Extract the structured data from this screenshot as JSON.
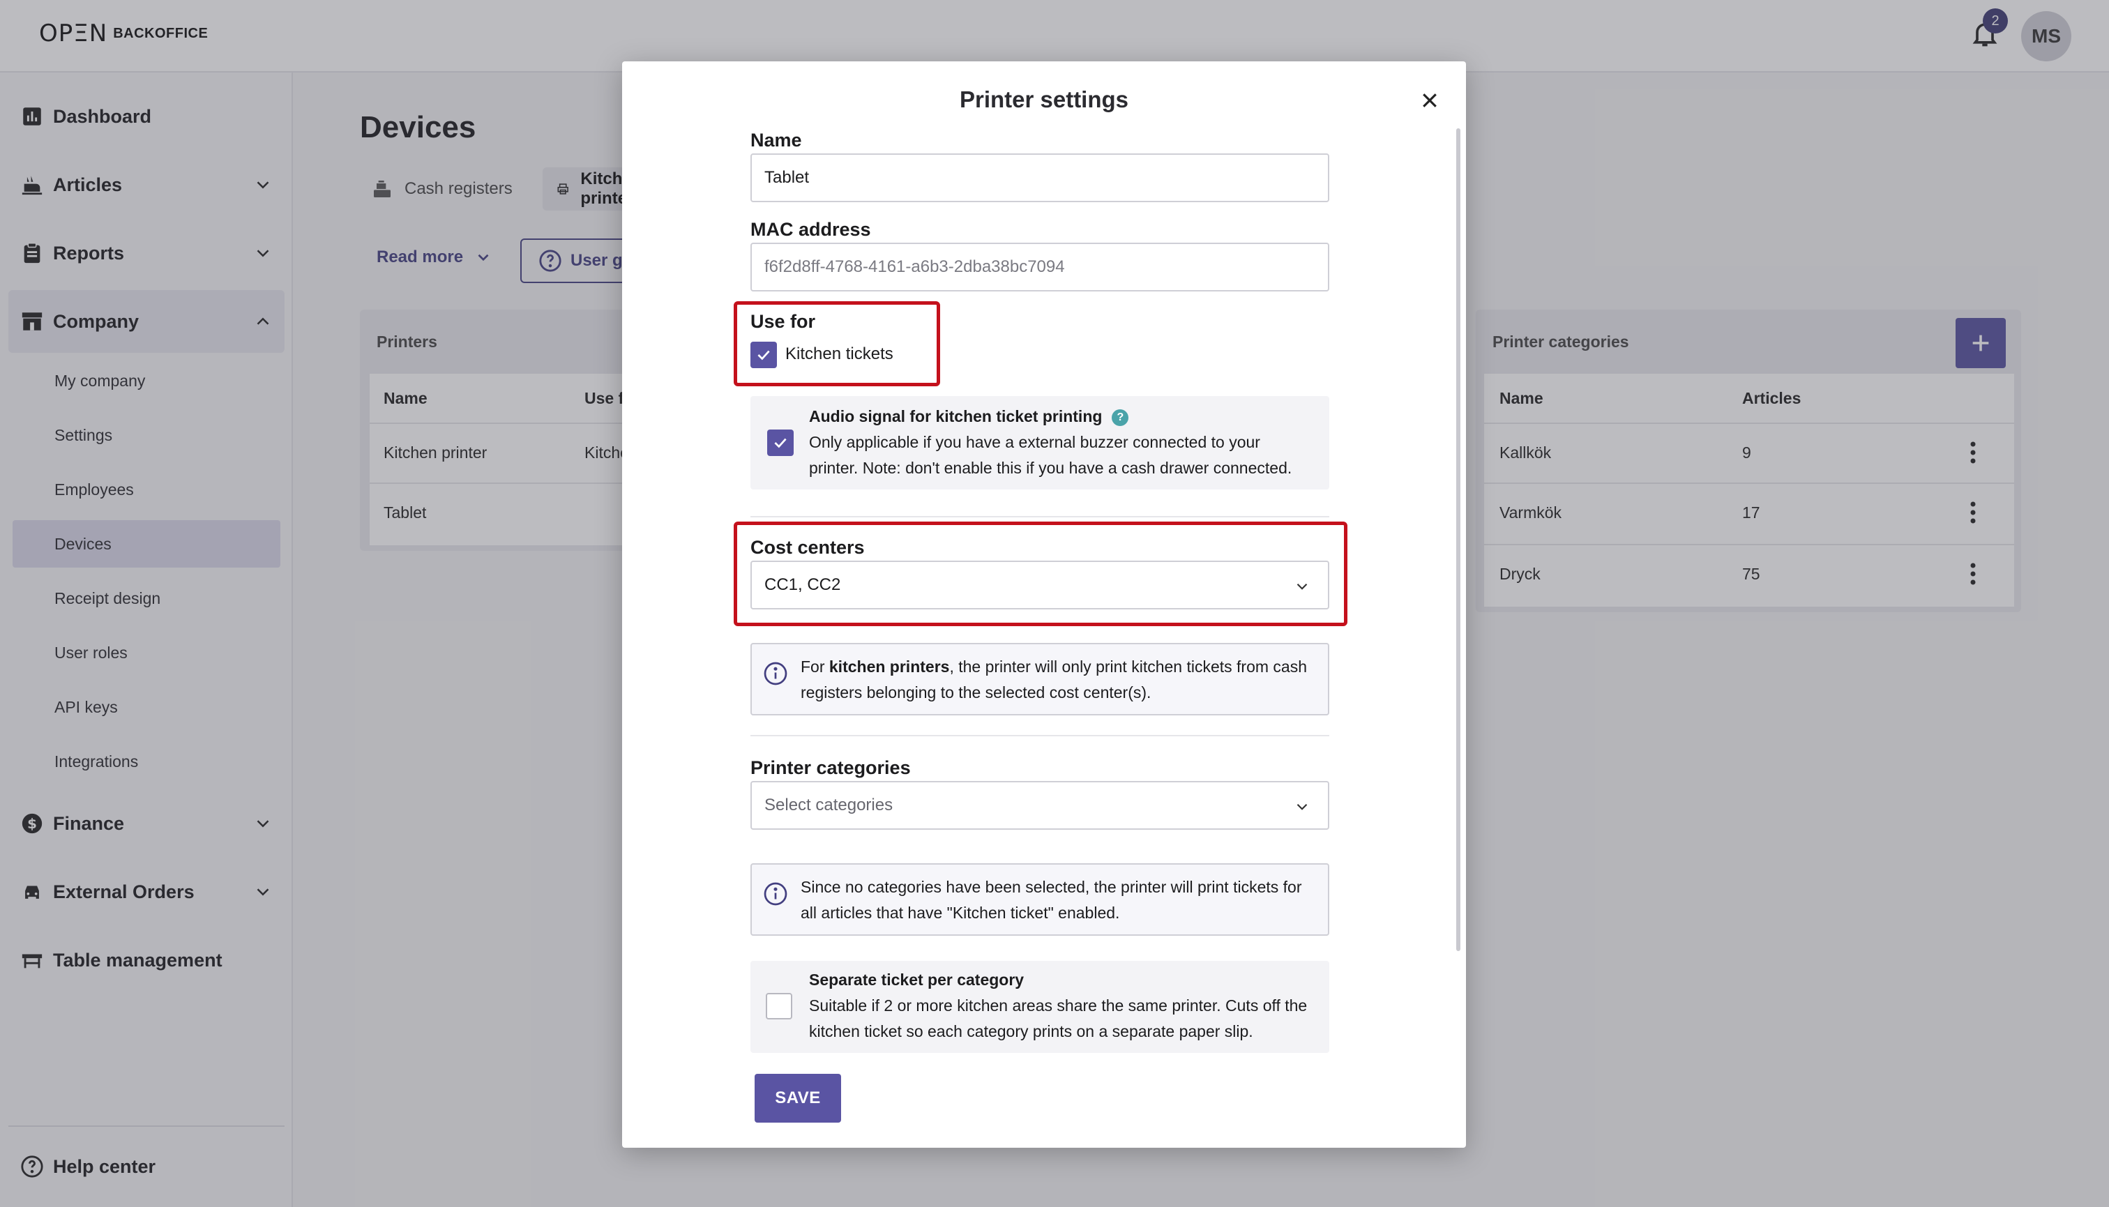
{
  "app": {
    "logo_mark": "ΟΡΞΝ",
    "logo_word": "BACKOFFICE",
    "notification_count": "2",
    "user_initials": "MS"
  },
  "sidebar": {
    "items": [
      {
        "label": "Dashboard",
        "icon": "chart-icon"
      },
      {
        "label": "Articles",
        "icon": "articles-icon"
      },
      {
        "label": "Reports",
        "icon": "clipboard-icon"
      },
      {
        "label": "Company",
        "icon": "store-icon"
      },
      {
        "label": "Finance",
        "icon": "dollar-icon"
      },
      {
        "label": "External Orders",
        "icon": "car-icon"
      },
      {
        "label": "Table management",
        "icon": "table-icon"
      }
    ],
    "company_sub": [
      "My company",
      "Settings",
      "Employees",
      "Devices",
      "Receipt design",
      "User roles",
      "API keys",
      "Integrations"
    ],
    "active_sub": "Devices",
    "help": "Help center"
  },
  "main": {
    "title": "Devices",
    "tabs": [
      {
        "label": "Cash registers"
      },
      {
        "label": "Kitchen printers"
      }
    ],
    "read_more": "Read more",
    "user_guide": "User guide",
    "printers": {
      "title": "Printers",
      "columns": [
        "Name",
        "Use for"
      ],
      "rows": [
        {
          "name": "Kitchen printer",
          "use_for": "Kitchen tickets"
        },
        {
          "name": "Tablet",
          "use_for": ""
        }
      ]
    },
    "printer_categories": {
      "title": "Printer categories",
      "columns": [
        "Name",
        "Articles"
      ],
      "rows": [
        {
          "name": "Kallkök",
          "articles": "9"
        },
        {
          "name": "Varmkök",
          "articles": "17"
        },
        {
          "name": "Dryck",
          "articles": "75"
        }
      ]
    }
  },
  "modal": {
    "title": "Printer settings",
    "name_label": "Name",
    "name_value": "Tablet",
    "mac_label": "MAC address",
    "mac_value": "f6f2d8ff-4768-4161-a6b3-2dba38bc7094",
    "use_for_label": "Use for",
    "kitchen_tickets_label": "Kitchen tickets",
    "kitchen_tickets_checked": true,
    "audio": {
      "title": "Audio signal for kitchen ticket printing",
      "help": "?",
      "text": "Only applicable if you have a external buzzer connected to your printer. Note: don't enable this if you have a cash drawer connected.",
      "checked": true
    },
    "cost_centers_label": "Cost centers",
    "cost_centers_value": "CC1, CC2",
    "cost_info_pre": "For ",
    "cost_info_bold": "kitchen printers",
    "cost_info_post": ", the printer will only print kitchen tickets from cash registers belonging to the selected cost center(s).",
    "printer_categories_label": "Printer categories",
    "printer_categories_placeholder": "Select categories",
    "categories_info": "Since no categories have been selected, the printer will print tickets for all articles that have \"Kitchen ticket\" enabled.",
    "separate": {
      "title": "Separate ticket per category",
      "text": "Suitable if 2 or more kitchen areas share the same printer. Cuts off the kitchen ticket so each category prints on a separate paper slip.",
      "checked": false
    },
    "save_label": "SAVE"
  },
  "colors": {
    "accent": "#5a54a3",
    "highlight": "#c4111c",
    "badge": "#3d3a73"
  }
}
